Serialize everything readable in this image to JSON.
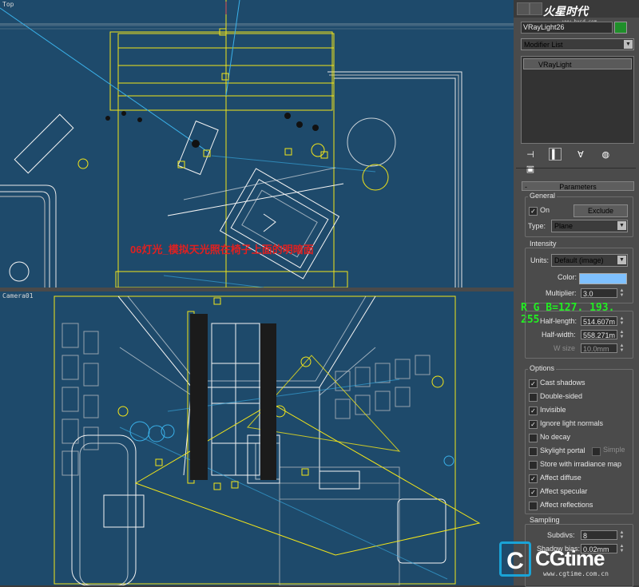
{
  "viewports": {
    "top_label": "Top",
    "camera_label": "Camera01",
    "annotation": "06灯光_模拟天光照在椅子上面的明暗面"
  },
  "rgb_readout": "R G B=127. 193. 255",
  "panel": {
    "logo": "火星时代",
    "logo_url": "www.hxsd.com",
    "object_name": "VRayLight26",
    "object_color": "#1f8f2a",
    "modifier_list": "Modifier List",
    "stack_item": "VRayLight",
    "stack_tools": [
      "pin-stack-icon",
      "show-end-result-icon",
      "make-unique-icon",
      "remove-modifier-icon",
      "configure-sets-icon"
    ],
    "rollout_title": "Parameters",
    "general": {
      "title": "General",
      "on_label": "On",
      "on_checked": true,
      "exclude_label": "Exclude",
      "type_label": "Type:",
      "type_value": "Plane"
    },
    "intensity": {
      "title": "Intensity",
      "units_label": "Units:",
      "units_value": "Default (image)",
      "color_label": "Color:",
      "color_value": "#7fc1ff",
      "multiplier_label": "Multiplier:",
      "multiplier_value": "3.0"
    },
    "size": {
      "title": "Size",
      "half_length_label": "Half-length:",
      "half_length_value": "514.607m",
      "half_width_label": "Half-width:",
      "half_width_value": "558.271m",
      "w_size_label": "W size",
      "w_size_value": "10.0mm"
    },
    "options": {
      "title": "Options",
      "items": [
        {
          "label": "Cast shadows",
          "checked": true
        },
        {
          "label": "Double-sided",
          "checked": false
        },
        {
          "label": "Invisible",
          "checked": true
        },
        {
          "label": "Ignore light normals",
          "checked": true
        },
        {
          "label": "No decay",
          "checked": false
        },
        {
          "label": "Skylight portal",
          "checked": false
        },
        {
          "label": "Store with irradiance map",
          "checked": false
        },
        {
          "label": "Affect diffuse",
          "checked": true
        },
        {
          "label": "Affect specular",
          "checked": true
        },
        {
          "label": "Affect reflections",
          "checked": false
        }
      ],
      "simple_label": "Simple"
    },
    "sampling": {
      "title": "Sampling",
      "subdivs_label": "Subdivs:",
      "subdivs_value": "8",
      "shadow_bias_label": "Shadow bias:",
      "shadow_bias_value": "0.02mm"
    }
  },
  "watermark": {
    "mark": "C",
    "text": "CGtime",
    "url": "www.cgtime.com.cn"
  },
  "colors": {
    "viewport_bg": "#1e4a6b",
    "wire_yellow": "#f2e51a",
    "wire_white": "#f4f4f4"
  }
}
